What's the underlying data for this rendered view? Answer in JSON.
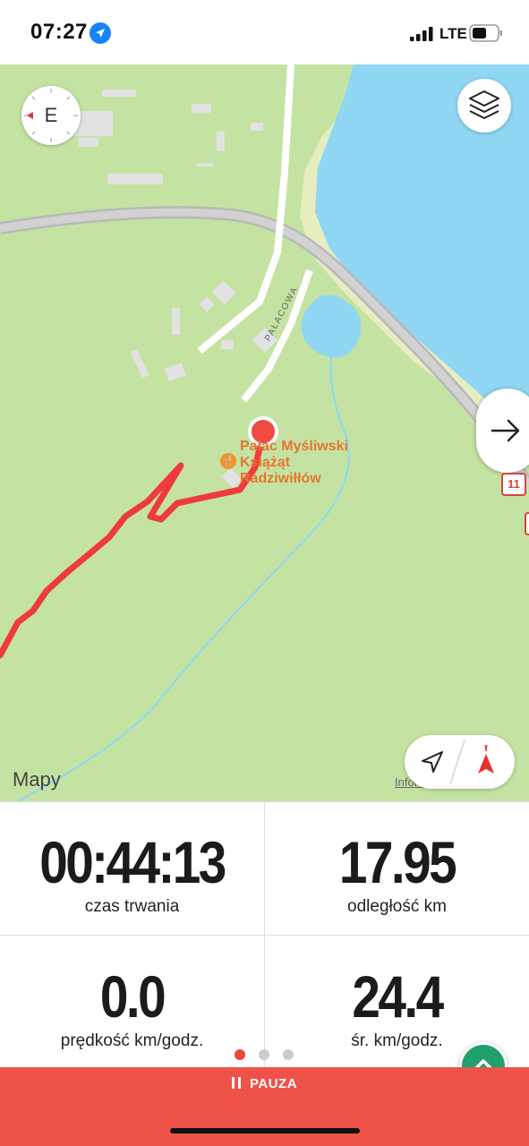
{
  "status_bar": {
    "time": "07:27",
    "network": "LTE",
    "icons": [
      "location-arrow-icon",
      "signal-icon",
      "battery-icon"
    ]
  },
  "map": {
    "compass_letter": "E",
    "poi_label_line1": "Pałac Myśliwski",
    "poi_label_line2": "Książąt",
    "poi_label_line3": "Radziwiłłów",
    "road_label": "PAŁACOWA",
    "road_number": "11",
    "attribution": "Mapy",
    "legal": "Informacje prawne",
    "colors": {
      "land": "#c4e3a3",
      "water": "#8fd7f3",
      "route": "#ef3b3b",
      "road": "#bdbdbd"
    }
  },
  "stats": {
    "duration_value": "00:44:13",
    "duration_label": "czas trwania",
    "distance_value": "17.95",
    "distance_label": "odległość km",
    "speed_value": "0.0",
    "speed_label": "prędkość km/godz.",
    "avg_value": "24.4",
    "avg_label": "śr. km/godz.",
    "page_count": 3,
    "active_page": 1
  },
  "pause": {
    "label": "PAUZA"
  }
}
